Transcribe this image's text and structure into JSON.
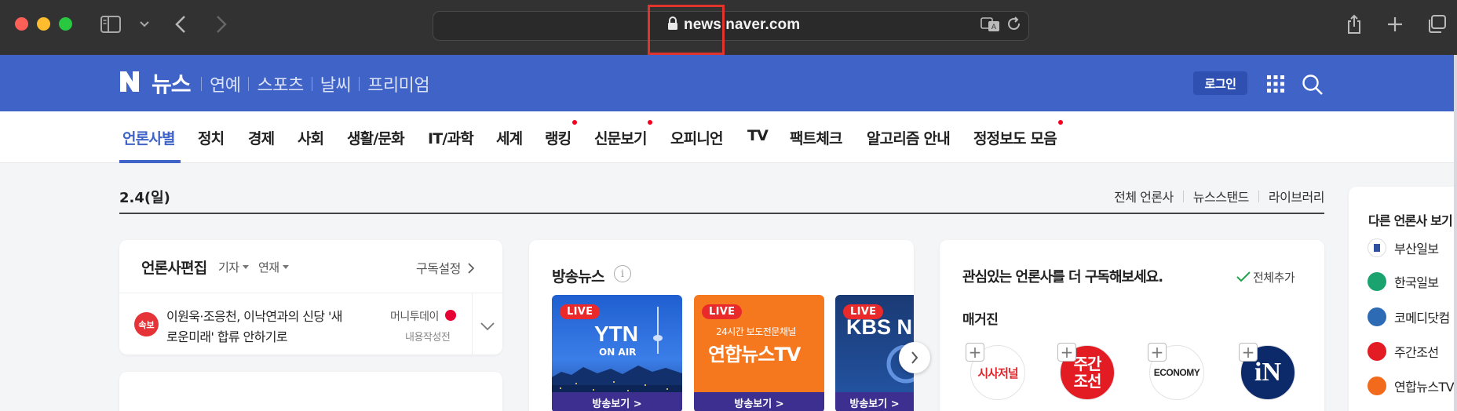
{
  "browser": {
    "url": "news.naver.com"
  },
  "header": {
    "logo_letter": "N",
    "title": "뉴스",
    "nav": [
      "연예",
      "스포츠",
      "날씨",
      "프리미엄"
    ],
    "login_label": "로그인"
  },
  "categories": [
    {
      "label": "언론사별",
      "active": true,
      "dot": false
    },
    {
      "label": "정치",
      "active": false,
      "dot": false
    },
    {
      "label": "경제",
      "active": false,
      "dot": false
    },
    {
      "label": "사회",
      "active": false,
      "dot": false
    },
    {
      "label": "생활/문화",
      "active": false,
      "dot": false
    },
    {
      "label": "IT/과학",
      "active": false,
      "dot": false
    },
    {
      "label": "세계",
      "active": false,
      "dot": false
    },
    {
      "label": "랭킹",
      "active": false,
      "dot": true
    },
    {
      "label": "신문보기",
      "active": false,
      "dot": true
    },
    {
      "label": "오피니언",
      "active": false,
      "dot": false
    },
    {
      "label": "TV",
      "active": false,
      "dot": false
    },
    {
      "label": "팩트체크",
      "active": false,
      "dot": false
    },
    {
      "label": "알고리즘 안내",
      "active": false,
      "dot": false
    },
    {
      "label": "정정보도 모음",
      "active": false,
      "dot": true
    }
  ],
  "date": "2.4(일)",
  "top_links": [
    "전체 언론사",
    "뉴스스탠드",
    "라이브러리"
  ],
  "editorial": {
    "title": "언론사편집",
    "filters": [
      "기자",
      "연재"
    ],
    "subscribe_settings": "구독설정",
    "breaking_badge": "속보",
    "headline_line1": "이원욱·조응천, 이낙연과의 신당 '새",
    "headline_line2": "로운미래' 합류 안하기로",
    "press": "머니투데이",
    "status": "내용작성전"
  },
  "broadcast": {
    "title": "방송뉴스",
    "info_icon": "info-icon",
    "items": [
      {
        "live": "LIVE",
        "name": "YTN",
        "sub": "ON AIR",
        "action": "방송보기 >"
      },
      {
        "live": "LIVE",
        "tagline": "24시간 보도전문채널",
        "name": "연합뉴스TV",
        "action": "방송보기 >"
      },
      {
        "live": "LIVE",
        "name": "KBS N",
        "action": "방송보기 >"
      }
    ]
  },
  "subscribe": {
    "title": "관심있는 언론사를 더 구독해보세요.",
    "add_all": "전체추가",
    "section": "매거진",
    "magazines": [
      "시사저널",
      "주간조선",
      "ECONOMY",
      "iN"
    ]
  },
  "sidebar": {
    "title": "다른 언론사 보기",
    "items": [
      {
        "name": "부산일보",
        "color": "#ffffff"
      },
      {
        "name": "한국일보",
        "color": "#1aa36f"
      },
      {
        "name": "코메디닷컴",
        "color": "#2d6bb5"
      },
      {
        "name": "주간조선",
        "color": "#e31b23"
      },
      {
        "name": "연합뉴스TV",
        "color": "#f26a1b"
      }
    ]
  },
  "colors": {
    "brand": "#4063c8",
    "chrome": "#323232",
    "highlight_box": "#e0342c",
    "new_dot": "#f5001e"
  }
}
